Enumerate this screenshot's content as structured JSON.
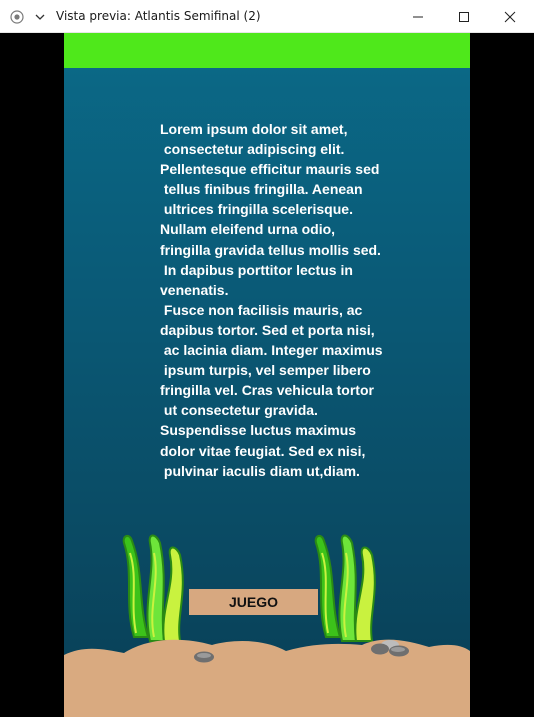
{
  "window": {
    "title": "Vista previa: Atlantis Semifinal (2)"
  },
  "game": {
    "topbar_color": "#4fe81b",
    "sand_color": "#d9aa80",
    "lorem_lines": [
      "Lorem ipsum dolor sit amet,",
      " consectetur adipiscing elit.",
      "Pellentesque efficitur mauris sed",
      " tellus finibus fringilla. Aenean",
      " ultrices fringilla scelerisque.",
      "Nullam eleifend urna odio,",
      "fringilla gravida tellus mollis sed.",
      " In dapibus porttitor lectus in",
      "venenatis.",
      " Fusce non facilisis mauris, ac",
      "dapibus tortor. Sed et porta nisi,",
      " ac lacinia diam. Integer maximus",
      " ipsum turpis, vel semper libero",
      "fringilla vel. Cras vehicula tortor",
      " ut consectetur gravida.",
      "Suspendisse luctus maximus",
      "dolor vitae feugiat. Sed ex nisi,",
      " pulvinar iaculis diam ut,diam."
    ],
    "play_button_label": "JUEGO"
  }
}
